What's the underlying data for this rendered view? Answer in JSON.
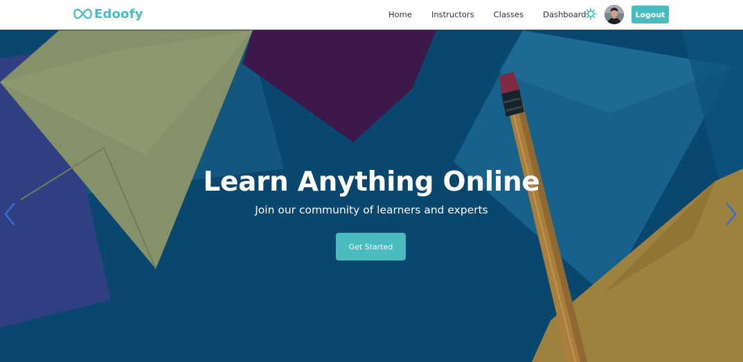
{
  "brand": {
    "name": "Edoofy"
  },
  "nav": {
    "links": [
      {
        "label": "Home"
      },
      {
        "label": "Instructors"
      },
      {
        "label": "Classes"
      },
      {
        "label": "Dashboard"
      }
    ],
    "theme_icon": "sun-icon",
    "avatar": "user-avatar",
    "logout_label": "Logout"
  },
  "hero": {
    "title": "Learn Anything Online",
    "subtitle": "Join our community of learners and experts",
    "cta_label": "Get Started",
    "prev_icon": "chevron-left-icon",
    "next_icon": "chevron-right-icon"
  },
  "colors": {
    "accent": "#49bcc0",
    "hero_overlay": "#0b4a72"
  }
}
